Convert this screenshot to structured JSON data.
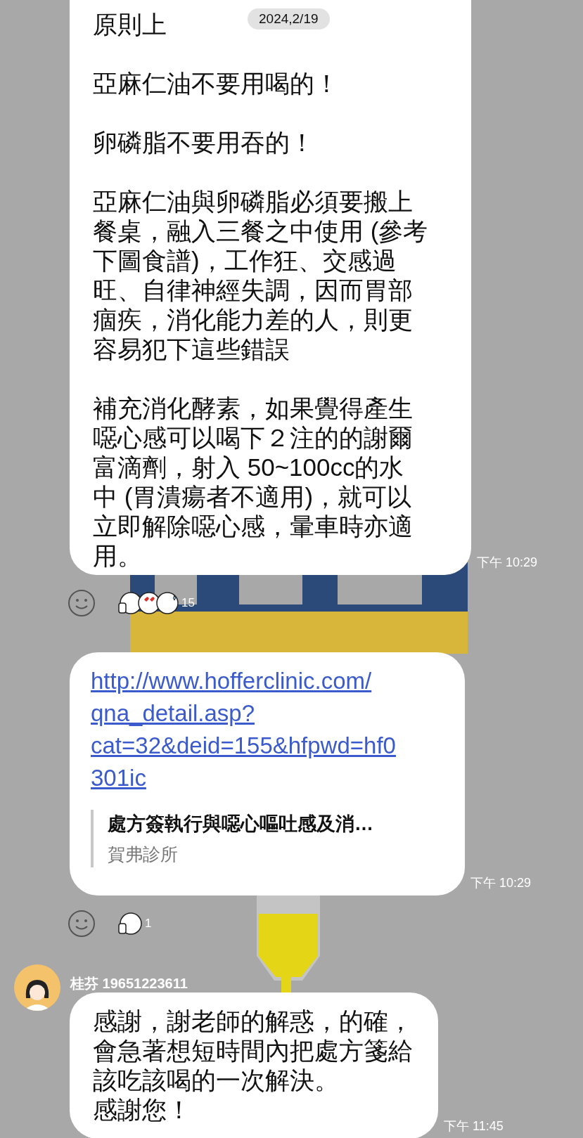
{
  "date_badge": "2024,2/19",
  "messages": [
    {
      "kind": "text",
      "paragraphs": [
        [
          "原則上"
        ],
        [
          "亞麻仁油不要用喝的！"
        ],
        [
          "卵磷脂不要用吞的！"
        ],
        [
          "亞麻仁油與卵磷脂必須要搬上",
          "餐桌，融入三餐之中使用 (參考",
          "下圖食譜)，工作狂、交感過",
          "旺、自律神經失調，因而胃部",
          "痼疾，消化能力差的人，則更",
          "容易犯下這些錯誤"
        ],
        [
          "補充消化酵素，如果覺得產生",
          "噁心感可以喝下２注的的謝爾",
          "富滴劑，射入 50~100cc的水",
          "中 (胃潰瘍者不適用)，就可以",
          "立即解除噁心感，暈車時亦適",
          "用。"
        ]
      ],
      "time": "下午 10:29",
      "reactions": {
        "count": "15",
        "stickers": [
          {
            "kind": "thumbs_up"
          },
          {
            "kind": "hearts"
          },
          {
            "kind": "worried"
          }
        ]
      }
    },
    {
      "kind": "link",
      "url_lines": [
        "http://www.hofferclinic.com/",
        "qna_detail.asp?",
        "cat=32&deid=155&hfpwd=hf0",
        "301ic"
      ],
      "preview": {
        "title": "處方簽執行與噁心嘔吐感及消…",
        "site": "賀弗診所"
      },
      "time": "下午 10:29",
      "reactions": {
        "count": "1",
        "stickers": [
          {
            "kind": "thumbs_up"
          }
        ]
      }
    },
    {
      "kind": "text",
      "sender": "桂芬 19651223611",
      "paragraphs": [
        [
          "感謝，謝老師的解惑，的確，",
          "會急著想短時間內把處方箋給",
          "該吃該喝的一次解決。",
          "感謝您！"
        ]
      ],
      "time": "下午 11:45"
    }
  ]
}
